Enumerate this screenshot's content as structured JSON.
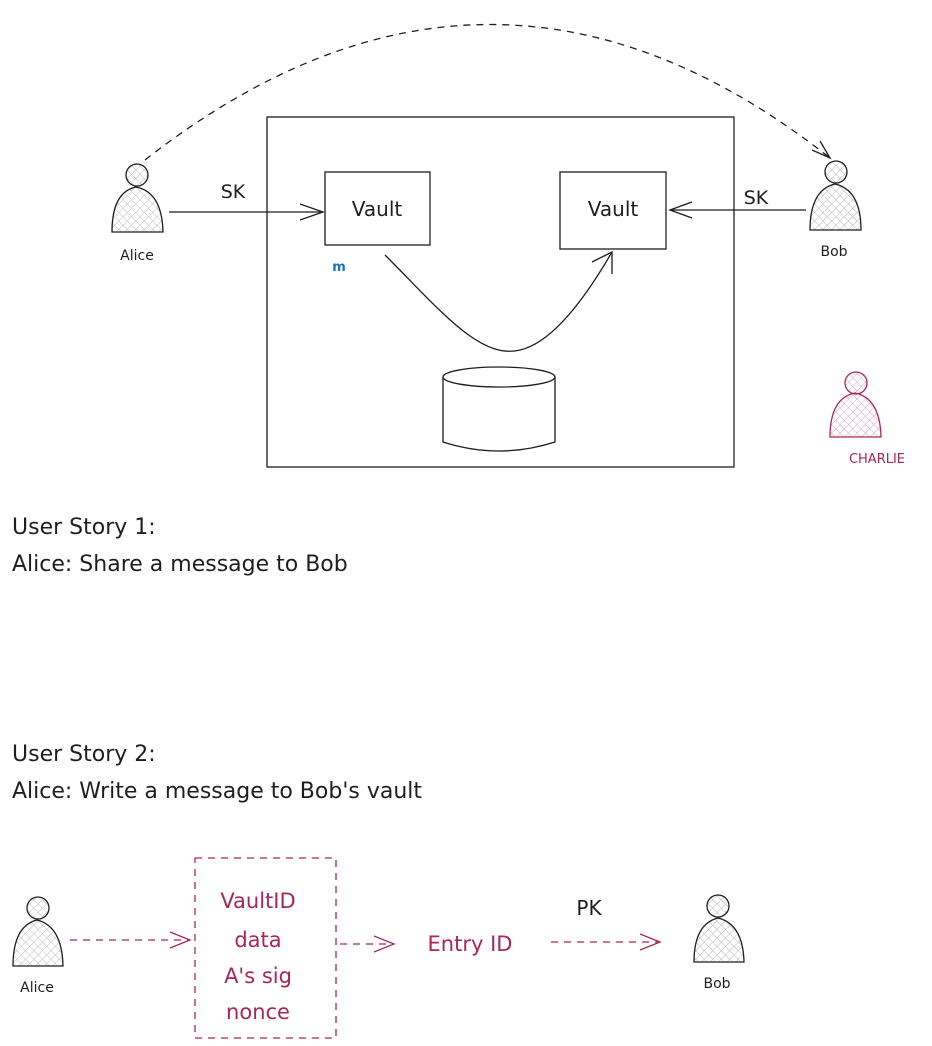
{
  "top_diagram": {
    "actors": {
      "alice": "Alice",
      "bob": "Bob",
      "charlie": "CHARLIE"
    },
    "vault_left": "Vault",
    "vault_right": "Vault",
    "left_arrow_label": "SK",
    "right_arrow_label": "SK",
    "m_label": "m"
  },
  "user_story_1": {
    "title": "User Story 1:",
    "text": "Alice: Share a message to Bob"
  },
  "user_story_2": {
    "title": "User Story 2:",
    "text": "Alice: Write a message to Bob's vault"
  },
  "bottom_diagram": {
    "alice": "Alice",
    "bob": "Bob",
    "box_lines": [
      "VaultID",
      "data",
      "A's sig",
      "nonce"
    ],
    "entry_id": "Entry ID",
    "pk_label": "PK"
  },
  "colors": {
    "ink": "#1e1e1e",
    "accent": "#a6265e",
    "m_blue": "#1971c2",
    "hatch": "#bbbbbb"
  }
}
